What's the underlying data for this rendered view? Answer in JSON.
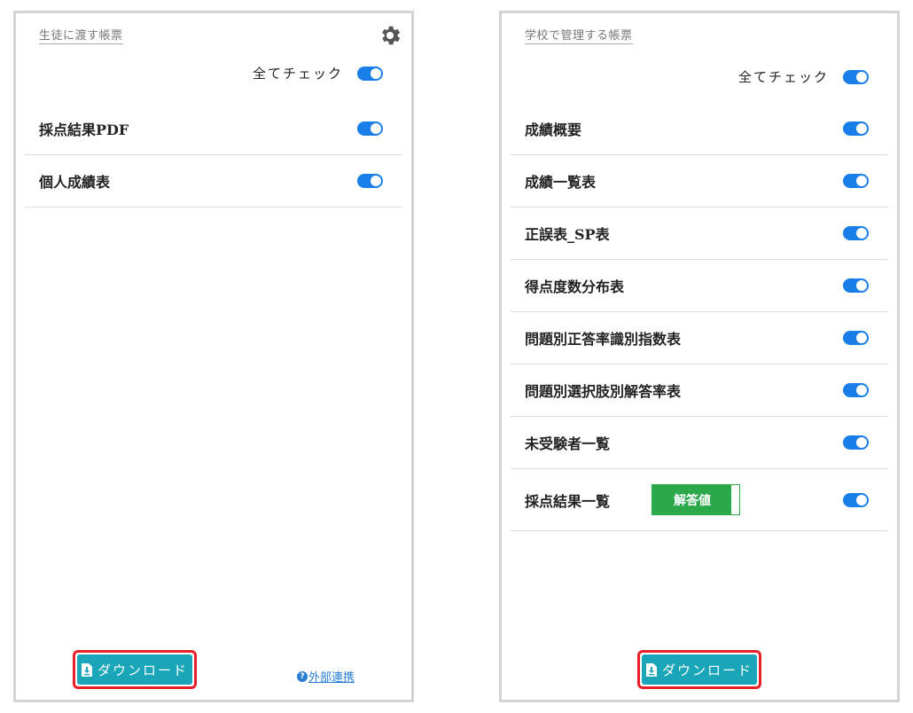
{
  "left": {
    "title": "生徒に渡す帳票",
    "check_all_label": "全てチェック",
    "items": [
      {
        "label": "採点結果PDF"
      },
      {
        "label": "個人成績表"
      }
    ],
    "download_label": "ダウンロード",
    "external_link_label": "外部連携"
  },
  "right": {
    "title": "学校で管理する帳票",
    "check_all_label": "全てチェック",
    "items": [
      {
        "label": "成績概要"
      },
      {
        "label": "成績一覧表"
      },
      {
        "label": "正誤表_SP表"
      },
      {
        "label": "得点度数分布表"
      },
      {
        "label": "問題別正答率識別指数表"
      },
      {
        "label": "問題別選択肢別解答率表"
      },
      {
        "label": "未受験者一覧"
      },
      {
        "label": "採点結果一覧",
        "answer_button_label": "解答値"
      }
    ],
    "download_label": "ダウンロード"
  },
  "colors": {
    "toggle_on": "#1a7ee8",
    "download_button": "#1aa6b8",
    "download_highlight": "#e8202a",
    "answer_button": "#2aa84a",
    "link": "#2a7fd4"
  },
  "icons": [
    "gear-icon",
    "file-download-icon",
    "question-circle-icon"
  ]
}
